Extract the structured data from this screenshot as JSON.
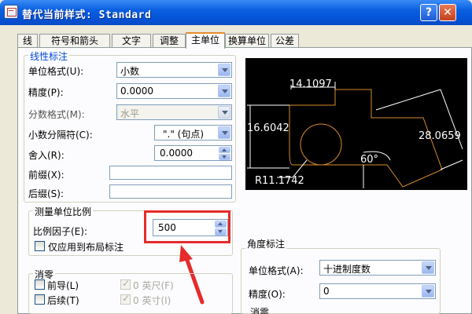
{
  "window": {
    "title": "替代当前样式: Standard",
    "help_label": "?",
    "close_label": "✕"
  },
  "tabs": [
    {
      "label": "线"
    },
    {
      "label": "符号和箭头"
    },
    {
      "label": "文字"
    },
    {
      "label": "调整"
    },
    {
      "label": "主单位",
      "active": true
    },
    {
      "label": "换算单位"
    },
    {
      "label": "公差"
    }
  ],
  "linear": {
    "section_title": "线性标注",
    "unit_format_label": "单位格式(U):",
    "unit_format_value": "小数",
    "precision_label": "精度(P):",
    "precision_value": "0.0000",
    "fraction_format_label": "分数格式(M):",
    "fraction_format_value": "水平",
    "decimal_sep_label": "小数分隔符(C):",
    "decimal_sep_value": "\".\" (句点)",
    "round_label": "舍入(R):",
    "round_value": "0.0000",
    "prefix_label": "前缀(X):",
    "prefix_value": "",
    "suffix_label": "后缀(S):",
    "suffix_value": ""
  },
  "scale": {
    "group_title": "测量单位比例",
    "factor_label": "比例因子(E):",
    "factor_value": "500",
    "layout_only_label": "仅应用到布局标注"
  },
  "zero_suppress_left": {
    "group_title": "消零",
    "leading_label": "前导(L)",
    "trailing_label": "后续(T)",
    "feet_label": "0 英尺(F)",
    "inches_label": "0 英寸(I)"
  },
  "preview": {
    "dim_top": "14.1097",
    "dim_left": "16.6042",
    "dim_right": "28.0659",
    "dim_angle": "60°",
    "dim_radius": "R11.1742"
  },
  "angular": {
    "group_title": "角度标注",
    "unit_format_label": "单位格式(A):",
    "unit_format_value": "十进制度数",
    "precision_label": "精度(O):",
    "precision_value": "0",
    "zero_suppress_title": "消零"
  },
  "colors": {
    "highlight": "#e52b2b",
    "geometry": "#d98b2b",
    "dim_lines": "#ffffff",
    "titlebar": "#0553d6"
  }
}
